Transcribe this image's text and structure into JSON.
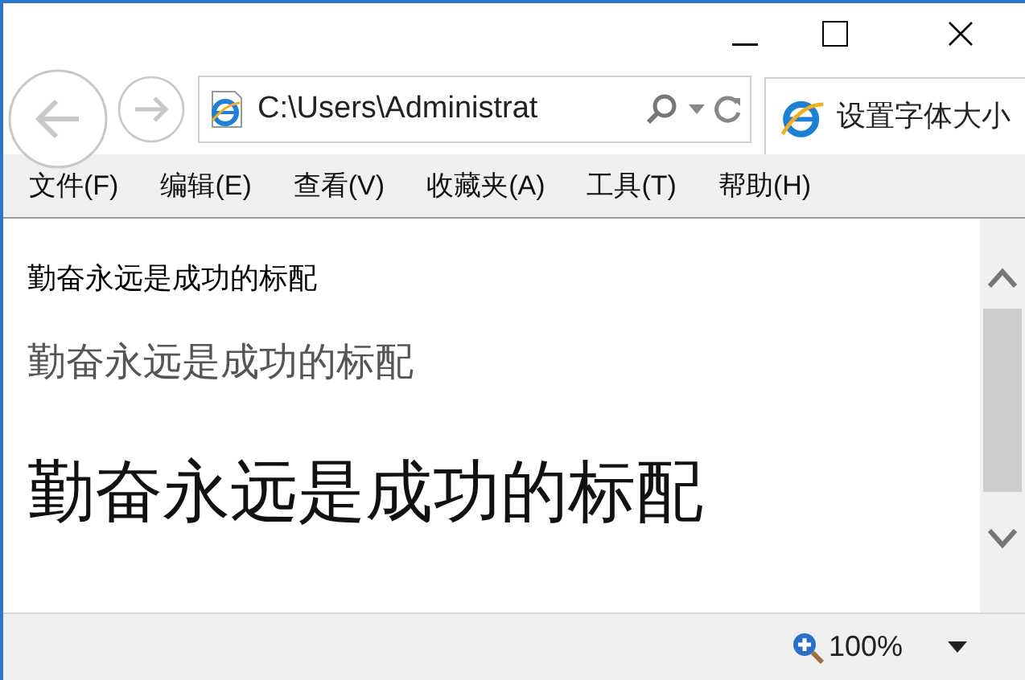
{
  "address_bar": {
    "value": "C:\\Users\\Administrat"
  },
  "tab": {
    "title": "设置字体大小"
  },
  "menu": [
    "文件(F)",
    "编辑(E)",
    "查看(V)",
    "收藏夹(A)",
    "工具(T)",
    "帮助(H)"
  ],
  "content": [
    "勤奋永远是成功的标配",
    "勤奋永远是成功的标配",
    "勤奋永远是成功的标配"
  ],
  "status_bar": {
    "zoom": "100%"
  }
}
